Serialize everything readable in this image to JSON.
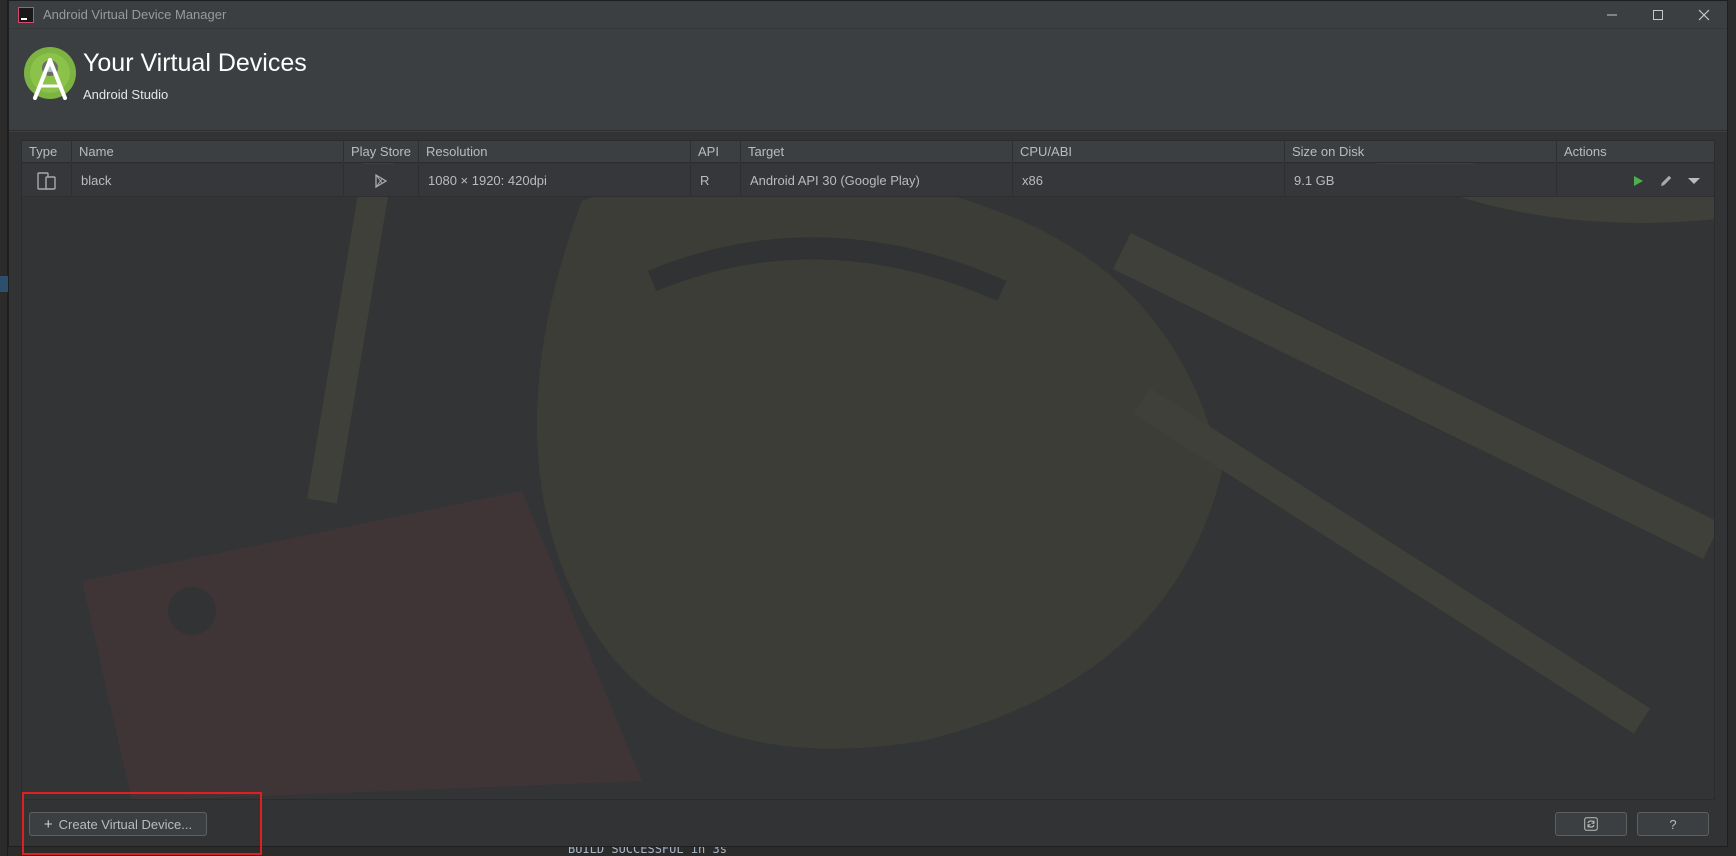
{
  "window": {
    "title": "Android Virtual Device Manager"
  },
  "header": {
    "title": "Your Virtual Devices",
    "subtitle": "Android Studio"
  },
  "table": {
    "columns": [
      "Type",
      "Name",
      "Play Store",
      "Resolution",
      "API",
      "Target",
      "CPU/ABI",
      "Size on Disk",
      "Actions"
    ],
    "rows": [
      {
        "type_icon": "phone-tablet-icon",
        "name": "black",
        "play_store_icon": "play-store-icon",
        "resolution": "1080 × 1920: 420dpi",
        "api": "R",
        "target": "Android API 30 (Google Play)",
        "cpu_abi": "x86",
        "size_on_disk": "9.1 GB",
        "actions": [
          "launch-icon",
          "edit-icon",
          "more-dropdown-icon"
        ]
      }
    ]
  },
  "footer": {
    "create_label": "Create Virtual Device...",
    "refresh_icon": "refresh-icon",
    "help_label": "?"
  },
  "background_console": {
    "text": "BUILD SUCCESSFUL in 3s"
  },
  "colors": {
    "window_bg": "#3c3f41",
    "table_bg": "#323436",
    "text": "#bbbbbb",
    "launch_green": "#4caf50",
    "android_green": "#7cb342",
    "highlight_red": "#e21e1e"
  }
}
